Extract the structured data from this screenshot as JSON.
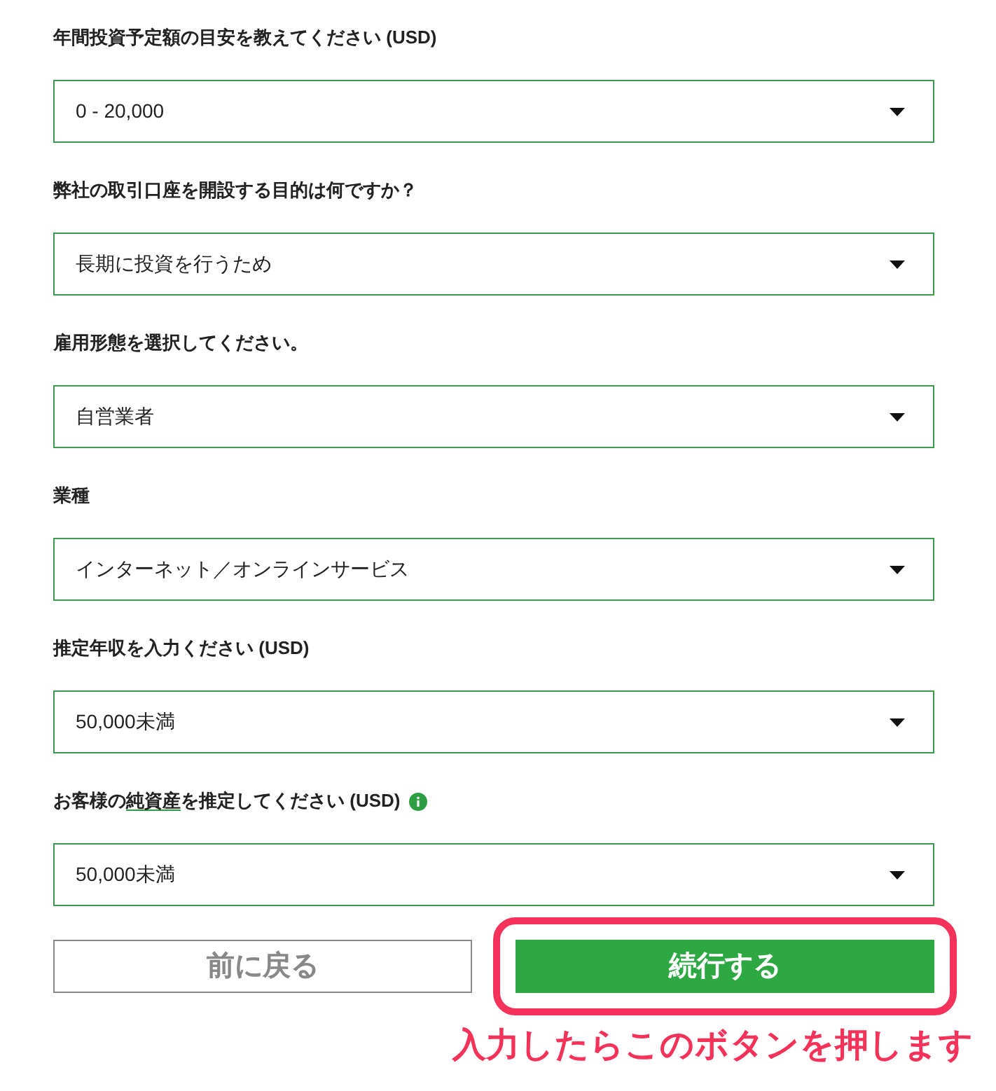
{
  "fields": [
    {
      "label": [
        {
          "text": "年間投資予定額の目安を教えてください (USD)",
          "underline": false
        }
      ],
      "info": false,
      "value": "0 - 20,000"
    },
    {
      "label": [
        {
          "text": "弊社の取引口座を開設する目的は何ですか？",
          "underline": false
        }
      ],
      "info": false,
      "value": "長期に投資を行うため"
    },
    {
      "label": [
        {
          "text": "雇用形態を選択してください。",
          "underline": false
        }
      ],
      "info": false,
      "value": "自営業者"
    },
    {
      "label": [
        {
          "text": "業種",
          "underline": false
        }
      ],
      "info": false,
      "value": "インターネット／オンラインサービス"
    },
    {
      "label": [
        {
          "text": "推定年収を入力ください (USD)",
          "underline": false
        }
      ],
      "info": false,
      "value": "50,000未満"
    },
    {
      "label": [
        {
          "text": "お客様の",
          "underline": false
        },
        {
          "text": "純資産",
          "underline": true
        },
        {
          "text": "を推定してください (USD)",
          "underline": false
        }
      ],
      "info": true,
      "value": "50,000未満"
    }
  ],
  "buttons": {
    "back": "前に戻る",
    "continue": "続行する",
    "continue_highlighted": true
  },
  "annotation": "入力したらこのボタンを押します"
}
